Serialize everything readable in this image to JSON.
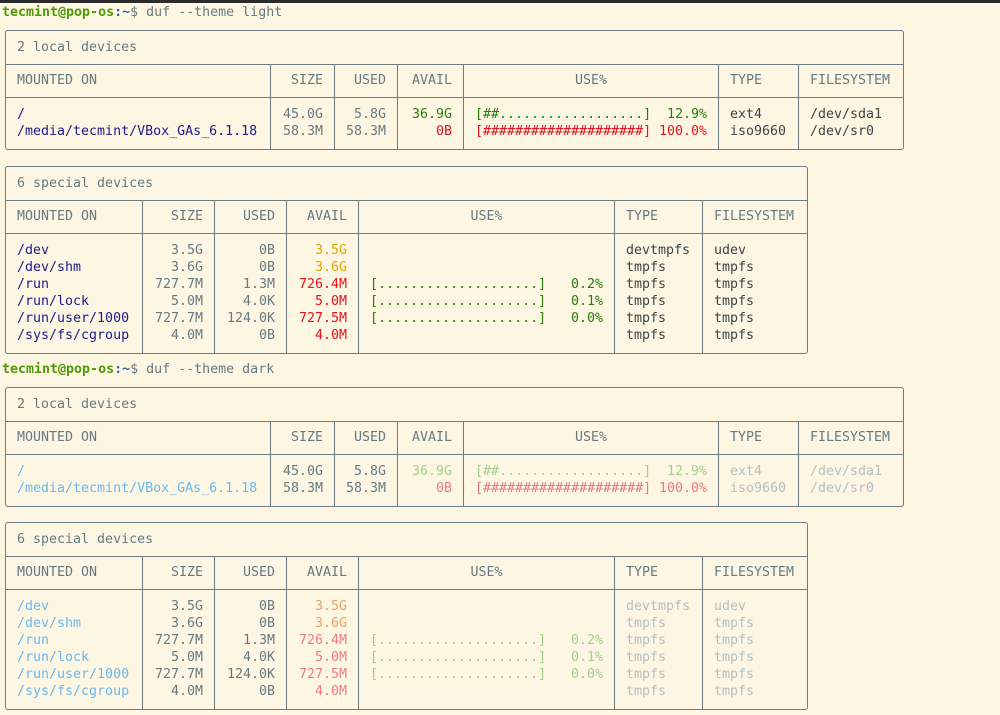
{
  "prompts": [
    {
      "user": "tecmint@pop-os",
      "path": ":~",
      "symbol": "$",
      "command": " duf --theme light"
    },
    {
      "user": "tecmint@pop-os",
      "path": ":~",
      "symbol": "$",
      "command": " duf --theme dark"
    }
  ],
  "colors": {
    "light": {
      "mount": "#1c1c8a",
      "num": "#657b83",
      "green": "#2a7d0a",
      "red": "#e2141c",
      "yellow": "#e0a800",
      "type": "#3b4548"
    },
    "dark": {
      "mount": "#6ab8f0",
      "num": "#657b83",
      "green": "#a3d18a",
      "red": "#f07a80",
      "yellow": "#e8a468",
      "type": "#b5bfc0"
    }
  },
  "headers": [
    "MOUNTED ON",
    "SIZE",
    "USED",
    "AVAIL",
    "USE%",
    "TYPE",
    "FILESYSTEM"
  ],
  "tables": [
    {
      "theme": "light",
      "kind": "local",
      "title": "2 local devices",
      "rows": [
        {
          "mount": "/",
          "size": "45.0G",
          "used": "5.8G",
          "avail": "36.9G",
          "avail_color": "green",
          "bar": "[##..................]",
          "pct": "12.9%",
          "pct_color": "green",
          "usage": 0.129,
          "type": "ext4",
          "fs": "/dev/sda1"
        },
        {
          "mount": "/media/tecmint/VBox_GAs_6.1.18",
          "size": "58.3M",
          "used": "58.3M",
          "avail": "0B",
          "avail_color": "red",
          "bar": "[####################]",
          "pct": "100.0%",
          "pct_color": "red",
          "usage": 1.0,
          "type": "iso9660",
          "fs": "/dev/sr0"
        }
      ]
    },
    {
      "theme": "light",
      "kind": "special",
      "title": "6 special devices",
      "rows": [
        {
          "mount": "/dev",
          "size": "3.5G",
          "used": "0B",
          "avail": "3.5G",
          "avail_color": "yellow",
          "bar": "",
          "pct": "",
          "type": "devtmpfs",
          "fs": "udev"
        },
        {
          "mount": "/dev/shm",
          "size": "3.6G",
          "used": "0B",
          "avail": "3.6G",
          "avail_color": "yellow",
          "bar": "",
          "pct": "",
          "type": "tmpfs",
          "fs": "tmpfs"
        },
        {
          "mount": "/run",
          "size": "727.7M",
          "used": "1.3M",
          "avail": "726.4M",
          "avail_color": "red",
          "bar": "[....................]",
          "pct": "0.2%",
          "pct_color": "green",
          "usage": 0.002,
          "type": "tmpfs",
          "fs": "tmpfs"
        },
        {
          "mount": "/run/lock",
          "size": "5.0M",
          "used": "4.0K",
          "avail": "5.0M",
          "avail_color": "red",
          "bar": "[....................]",
          "pct": "0.1%",
          "pct_color": "green",
          "usage": 0.001,
          "type": "tmpfs",
          "fs": "tmpfs"
        },
        {
          "mount": "/run/user/1000",
          "size": "727.7M",
          "used": "124.0K",
          "avail": "727.5M",
          "avail_color": "red",
          "bar": "[....................]",
          "pct": "0.0%",
          "pct_color": "green",
          "usage": 0.0,
          "type": "tmpfs",
          "fs": "tmpfs"
        },
        {
          "mount": "/sys/fs/cgroup",
          "size": "4.0M",
          "used": "0B",
          "avail": "4.0M",
          "avail_color": "red",
          "bar": "",
          "pct": "",
          "type": "tmpfs",
          "fs": "tmpfs"
        }
      ]
    },
    {
      "theme": "dark",
      "kind": "local",
      "title": "2 local devices",
      "rows": [
        {
          "mount": "/",
          "size": "45.0G",
          "used": "5.8G",
          "avail": "36.9G",
          "avail_color": "green",
          "bar": "[##..................]",
          "pct": "12.9%",
          "pct_color": "green",
          "usage": 0.129,
          "type": "ext4",
          "fs": "/dev/sda1"
        },
        {
          "mount": "/media/tecmint/VBox_GAs_6.1.18",
          "size": "58.3M",
          "used": "58.3M",
          "avail": "0B",
          "avail_color": "red",
          "bar": "[####################]",
          "pct": "100.0%",
          "pct_color": "red",
          "usage": 1.0,
          "type": "iso9660",
          "fs": "/dev/sr0"
        }
      ]
    },
    {
      "theme": "dark",
      "kind": "special",
      "title": "6 special devices",
      "rows": [
        {
          "mount": "/dev",
          "size": "3.5G",
          "used": "0B",
          "avail": "3.5G",
          "avail_color": "yellow",
          "bar": "",
          "pct": "",
          "type": "devtmpfs",
          "fs": "udev"
        },
        {
          "mount": "/dev/shm",
          "size": "3.6G",
          "used": "0B",
          "avail": "3.6G",
          "avail_color": "yellow",
          "bar": "",
          "pct": "",
          "type": "tmpfs",
          "fs": "tmpfs"
        },
        {
          "mount": "/run",
          "size": "727.7M",
          "used": "1.3M",
          "avail": "726.4M",
          "avail_color": "red",
          "bar": "[....................]",
          "pct": "0.2%",
          "pct_color": "green",
          "usage": 0.002,
          "type": "tmpfs",
          "fs": "tmpfs"
        },
        {
          "mount": "/run/lock",
          "size": "5.0M",
          "used": "4.0K",
          "avail": "5.0M",
          "avail_color": "red",
          "bar": "[....................]",
          "pct": "0.1%",
          "pct_color": "green",
          "usage": 0.001,
          "type": "tmpfs",
          "fs": "tmpfs"
        },
        {
          "mount": "/run/user/1000",
          "size": "727.7M",
          "used": "124.0K",
          "avail": "727.5M",
          "avail_color": "red",
          "bar": "[....................]",
          "pct": "0.0%",
          "pct_color": "green",
          "usage": 0.0,
          "type": "tmpfs",
          "fs": "tmpfs"
        },
        {
          "mount": "/sys/fs/cgroup",
          "size": "4.0M",
          "used": "0B",
          "avail": "4.0M",
          "avail_color": "red",
          "bar": "",
          "pct": "",
          "type": "tmpfs",
          "fs": "tmpfs"
        }
      ]
    }
  ]
}
